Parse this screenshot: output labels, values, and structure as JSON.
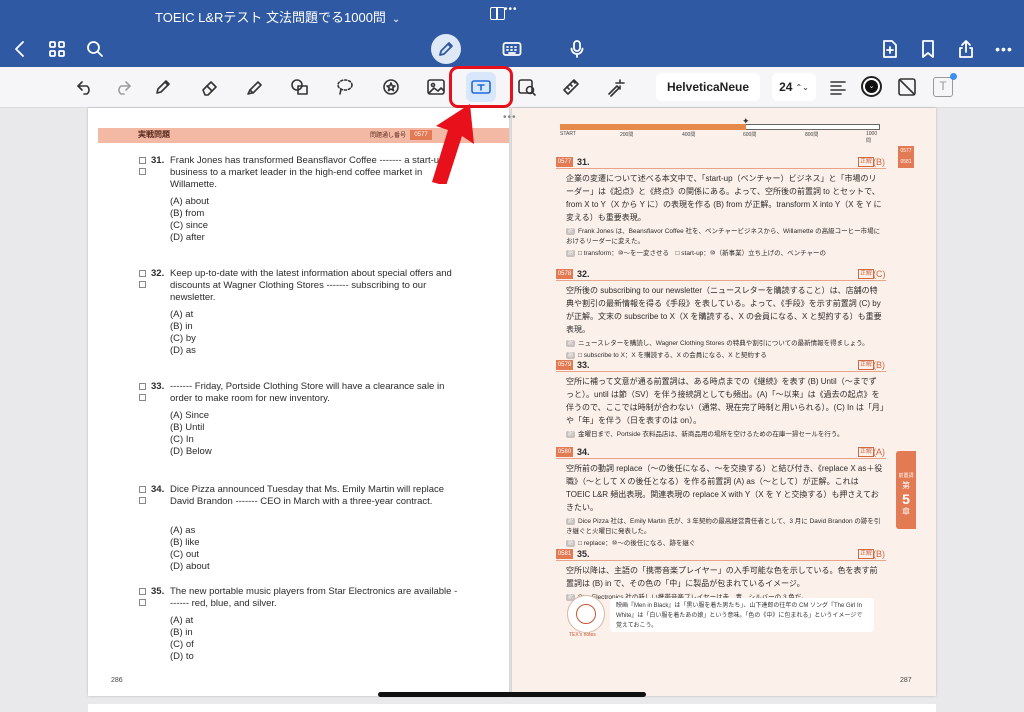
{
  "app": {
    "title": "TOEIC L&Rテスト 文法問題でる1000問",
    "title_chevron": "⌄"
  },
  "nav": {
    "back_icon": "chevron-left-icon",
    "grid_icon": "grid-icon",
    "search_icon": "search-icon",
    "pencil_mode_icon": "pencil-icon",
    "keyboard_icon": "keyboard-icon",
    "mic_icon": "microphone-icon",
    "new_page_icon": "add-page-icon",
    "bookmark_icon": "bookmark-icon",
    "share_icon": "share-icon",
    "more_icon": "more-icon",
    "more_glyph": "•••"
  },
  "toolbar": {
    "font_name": "HelveticaNeue",
    "font_size": "24",
    "font_size_arrows": "⌃⌄",
    "selected_tool": "text-box",
    "text_color": "#111111",
    "textbox_style_glyph": "T",
    "color_glyph": "⌄"
  },
  "accent": {
    "brand_blue": "#2f5aa3",
    "highlight_red": "#e8101a",
    "page_orange": "#e27a53"
  },
  "left_page": {
    "practice_title": "実戦問題",
    "question_no_label": "問題通し番号",
    "question_no": "0577",
    "page_number": "286",
    "questions": [
      {
        "num": "31.",
        "stem": "Frank Jones has transformed Beansflavor Coffee ------- a start-up business to a market leader in the high-end coffee market in Willamette.",
        "options": [
          "(A) about",
          "(B) from",
          "(C) since",
          "(D) after"
        ]
      },
      {
        "num": "32.",
        "stem": "Keep up-to-date with the latest information about special offers and discounts at Wagner Clothing Stores ------- subscribing to our newsletter.",
        "options": [
          "(A) at",
          "(B) in",
          "(C) by",
          "(D) as"
        ]
      },
      {
        "num": "33.",
        "stem": "------- Friday, Portside Clothing Store will have a clearance sale in order to make room for new inventory.",
        "options": [
          "(A) Since",
          "(B) Until",
          "(C) In",
          "(D) Below"
        ]
      },
      {
        "num": "34.",
        "stem": "Dice Pizza announced Tuesday that Ms. Emily Martin will replace David Brandon ------- CEO in March with a three-year contract.",
        "options": [
          "(A) as",
          "(B) like",
          "(C) out",
          "(D) about"
        ]
      },
      {
        "num": "35.",
        "stem": "The new portable music players from Star Electronics are available ------- red, blue, and silver.",
        "options": [
          "(A) at",
          "(B) in",
          "(C) of",
          "(D) to"
        ]
      }
    ]
  },
  "right_page": {
    "page_number": "287",
    "progress": {
      "start_label": "START",
      "marks": [
        "200問",
        "400問",
        "600問",
        "800問",
        "1000問"
      ],
      "fraction": 0.58
    },
    "side_tab_top": "0577 0581",
    "chapter_label": "前置詞",
    "chapter_num": "5",
    "chapter_suffix": "章",
    "answers": [
      {
        "qid": "0577",
        "num": "31.",
        "level": "正解",
        "key": "(B)",
        "body": "企業の変遷について述べる本文中で、「start-up（ベンチャー）ビジネス」と「市場のリーダー」は《起点》と《終点》の関係にある。よって、空所後の前置詞 to とセットで、from X to Y（X から Y に）の表現を作る (B) from が正解。transform X into Y（X を Y に変える）も重要表現。",
        "trans": "Frank Jones は、Beansflavor Coffee 社を、ベンチャービジネスから、Willamette の高級コーヒー市場におけるリーダーに変えた。",
        "words": "□ transform：⑩〜を一変させる　□ start-up：⑩（新事業）立ち上げの、ベンチャーの"
      },
      {
        "qid": "0578",
        "num": "32.",
        "level": "正解",
        "key": "(C)",
        "body": "空所後の subscribing to our newsletter（ニュースレターを購読すること）は、店舗の特典や割引の最新情報を得る《手段》を表している。よって、《手段》を示す前置詞 (C) by が正解。文末の subscribe to X（X を購読する、X の会員になる、X と契約する）も重要表現。",
        "trans": "ニュースレターを購読し、Wagner Clothing Stores の特典や割引についての最新情報を得ましょう。",
        "words": "□ subscribe to X：X を購読する、X の会員になる、X と契約する"
      },
      {
        "qid": "0579",
        "num": "33.",
        "level": "正解",
        "key": "(B)",
        "body": "空所に補って文意が通る前置詞は、ある時点までの《継続》を表す (B) Until（〜までずっと）。until は節（SV）を伴う接続詞としても頻出。(A)「〜以来」は《過去の起点》を伴うので、ここでは時制が合わない（通常、現在完了時制と用いられる）。(C) In は「月」や「年」を伴う（日を表すのは on）。",
        "trans": "金曜日まで、Portside 衣料品店は、新商品用の場所を空けるための在庫一掃セールを行う。",
        "words": ""
      },
      {
        "qid": "0580",
        "num": "34.",
        "level": "正解",
        "key": "(A)",
        "body": "空所前の動詞 replace（〜の後任になる、〜を交換する）と結び付き、《replace X as＋役職》（〜として X の後任となる）を作る前置詞 (A) as（〜として）が正解。これは TOEIC L&R 頻出表現。関連表現の replace X with Y（X を Y と交換する）も押さえておきたい。",
        "trans": "Dice Pizza 社は、Emily Martin 氏が、3 年契約の最高経営責任者として、3 月に David Brandon の跡を引き継ぐと火曜日に発表した。",
        "words": "□ replace：⑩〜の後任になる、跡を継ぐ"
      },
      {
        "qid": "0581",
        "num": "35.",
        "level": "正解",
        "key": "(B)",
        "body": "空所以降は、主語の「携帯音楽プレイヤー」の入手可能な色を示している。色を表す前置詞は (B) in で、その色の「中」に製品が包まれているイメージ。",
        "trans": "Star Electronics 社の新しい携帯音楽プレイヤーは赤、青、シルバーの 3 色だ。",
        "words": ""
      }
    ],
    "tex_note": "映画『Men in Black』は「黒い服を着た男たち」、山下達郎の往年の CM ソング『The Girl In White』は「白い服を着たあの娘」という意味。「色の《中》に包まれる」というイメージで覚えておこう。",
    "mascot_label": "TEX's notes"
  }
}
